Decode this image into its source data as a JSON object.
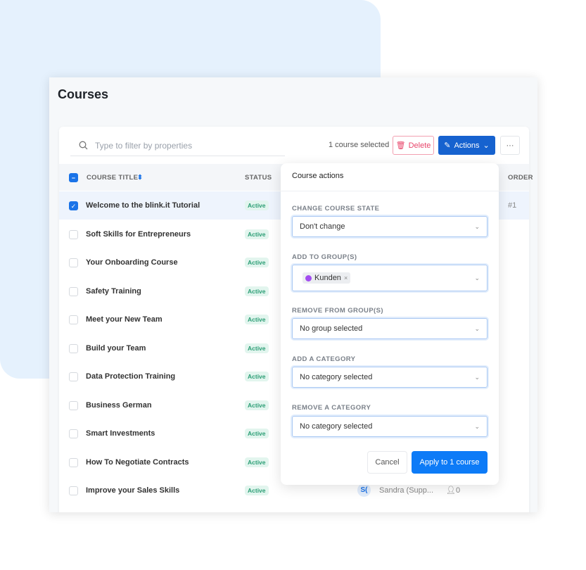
{
  "page": {
    "title": "Courses"
  },
  "toolbar": {
    "search_placeholder": "Type to filter by properties",
    "selected_count": "1 course selected",
    "delete_label": "Delete",
    "actions_label": "Actions",
    "more_label": "···"
  },
  "table": {
    "headers": {
      "title": "COURSE TITLE",
      "status": "STATUS",
      "order": "ORDER"
    },
    "rows": [
      {
        "title": "Welcome to the blink.it Tutorial",
        "status": "Active",
        "selected": true,
        "order": "#1"
      },
      {
        "title": "Soft Skills for Entrepreneurs",
        "status": "Active"
      },
      {
        "title": "Your Onboarding Course",
        "status": "Active"
      },
      {
        "title": "Safety Training",
        "status": "Active"
      },
      {
        "title": "Meet your New Team",
        "status": "Active"
      },
      {
        "title": "Build your Team",
        "status": "Active"
      },
      {
        "title": "Data Protection Training",
        "status": "Active"
      },
      {
        "title": "Business German",
        "status": "Active"
      },
      {
        "title": "Smart Investments",
        "status": "Active"
      },
      {
        "title": "How To Negotiate Contracts",
        "status": "Active"
      },
      {
        "title": "Improve your Sales Skills",
        "status": "Active",
        "avatar": "S(",
        "author": "Sandra (Supp...",
        "participants": "0"
      }
    ]
  },
  "popup": {
    "title": "Course actions",
    "change_state": {
      "label": "CHANGE COURSE STATE",
      "value": "Don't change"
    },
    "add_groups": {
      "label": "ADD TO GROUP(S)",
      "chip": "Kunden",
      "chip_color": "#a34df0"
    },
    "remove_groups": {
      "label": "REMOVE FROM GROUP(S)",
      "value": "No group selected"
    },
    "add_category": {
      "label": "ADD A CATEGORY",
      "value": "No category selected"
    },
    "remove_category": {
      "label": "REMOVE A CATEGORY",
      "value": "No category selected"
    },
    "cancel_label": "Cancel",
    "apply_label": "Apply to 1 course"
  }
}
